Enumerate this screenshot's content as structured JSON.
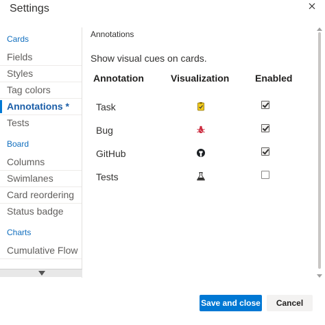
{
  "dialog": {
    "title": "Settings",
    "close_icon": "close-icon"
  },
  "nav": {
    "groups": [
      {
        "label": "Cards",
        "items": [
          {
            "label": "Fields",
            "selected": false
          },
          {
            "label": "Styles",
            "selected": false
          },
          {
            "label": "Tag colors",
            "selected": false
          },
          {
            "label": "Annotations *",
            "selected": true
          },
          {
            "label": "Tests",
            "selected": false
          }
        ]
      },
      {
        "label": "Board",
        "items": [
          {
            "label": "Columns",
            "selected": false
          },
          {
            "label": "Swimlanes",
            "selected": false
          },
          {
            "label": "Card reordering",
            "selected": false
          },
          {
            "label": "Status badge",
            "selected": false
          }
        ]
      },
      {
        "label": "Charts",
        "items": [
          {
            "label": "Cumulative Flow",
            "selected": false
          }
        ]
      }
    ],
    "scroll_down_icon": "triangle-down-icon"
  },
  "content": {
    "section_title": "Annotations",
    "description": "Show visual cues on cards.",
    "table": {
      "headers": {
        "annotation": "Annotation",
        "visualization": "Visualization",
        "enabled": "Enabled"
      },
      "rows": [
        {
          "name": "Task",
          "icon": "clipboard-check-icon",
          "enabled": true
        },
        {
          "name": "Bug",
          "icon": "bug-icon",
          "enabled": true
        },
        {
          "name": "GitHub",
          "icon": "github-icon",
          "enabled": true
        },
        {
          "name": "Tests",
          "icon": "flask-icon",
          "enabled": false
        }
      ]
    }
  },
  "footer": {
    "save_label": "Save and close",
    "cancel_label": "Cancel"
  },
  "colors": {
    "accent": "#0078d4",
    "nav_group": "#106ebe",
    "selected_text": "#1b5ea8",
    "task_icon": "#d8b700",
    "bug_icon": "#cc293d"
  }
}
